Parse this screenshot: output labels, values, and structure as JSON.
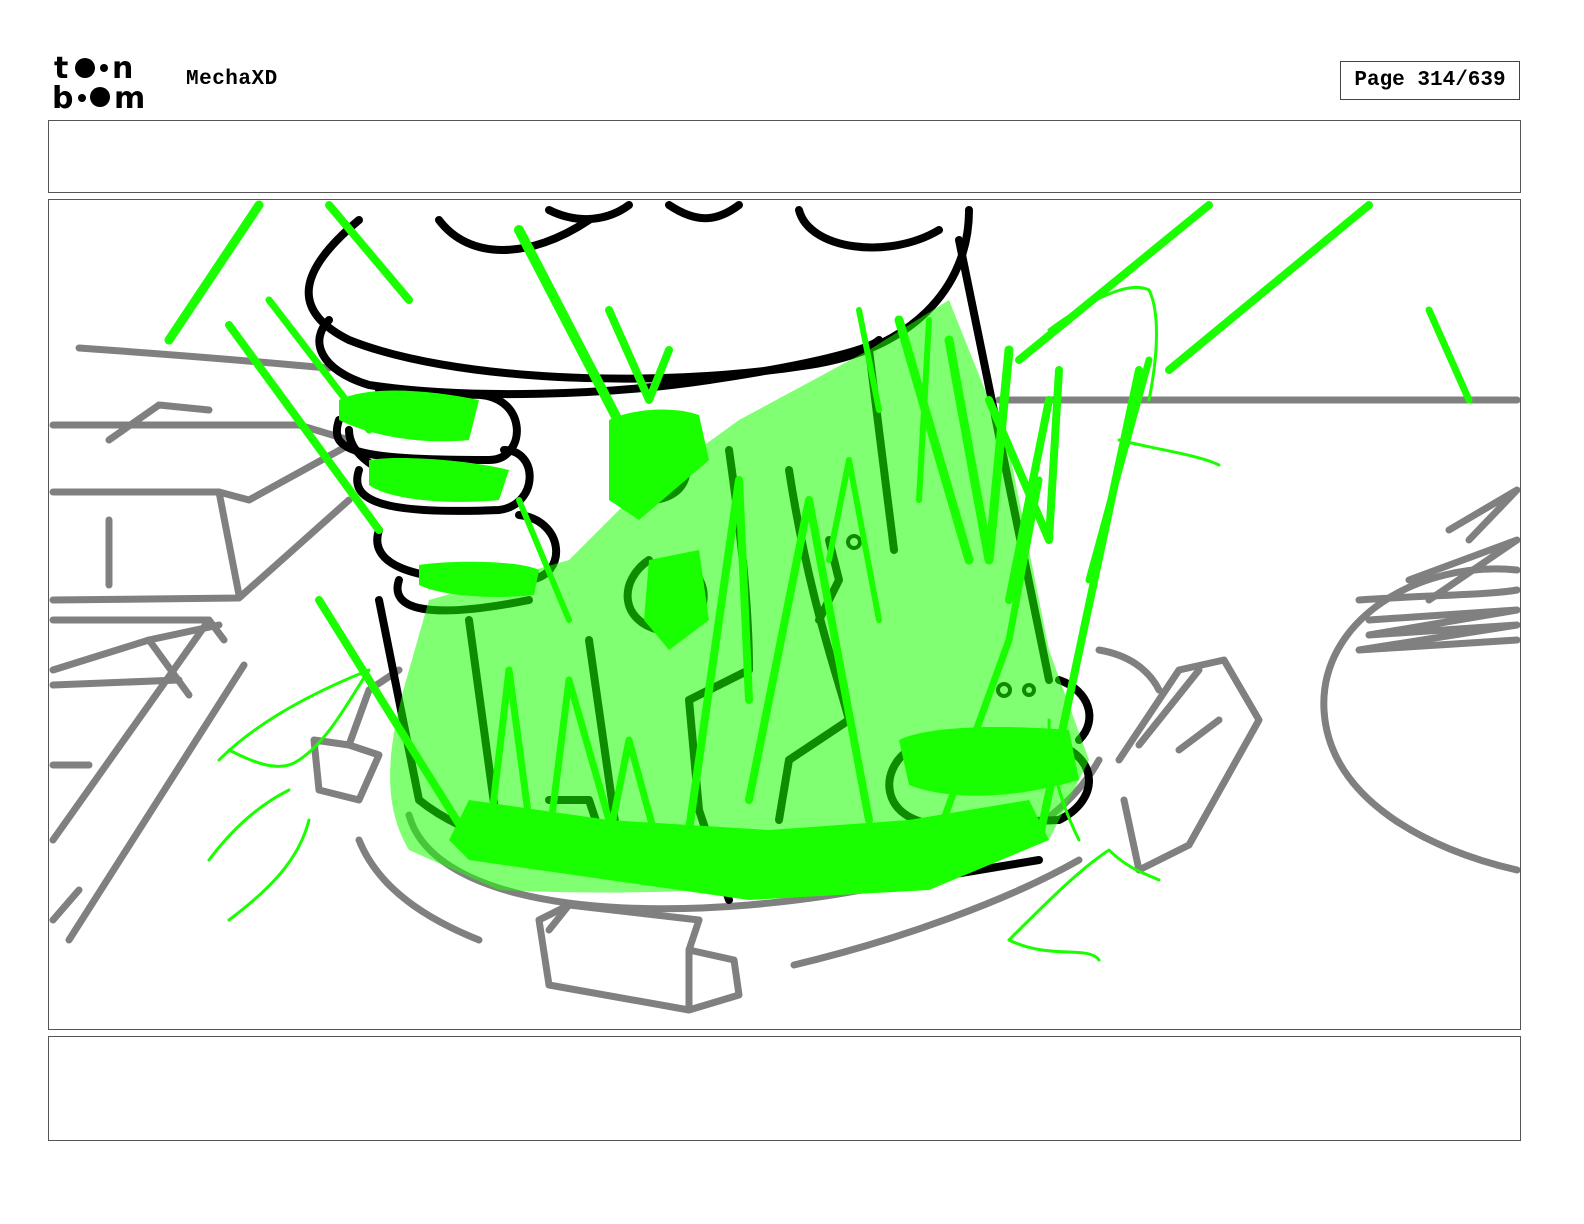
{
  "header": {
    "logo_text": "toon boom",
    "project_title": "MechaXD",
    "page_label": "Page 314/639"
  },
  "panel": {
    "caption_top": "",
    "caption_bottom": ""
  }
}
